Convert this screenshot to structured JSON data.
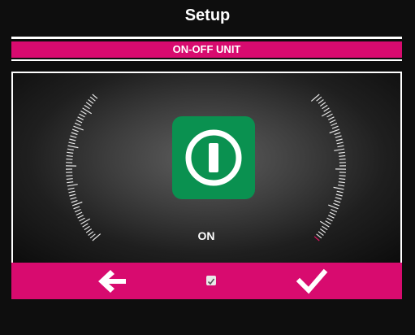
{
  "header": {
    "title": "Setup"
  },
  "section": {
    "title": "ON-OFF UNIT"
  },
  "control": {
    "state_label": "ON",
    "button_color": "#0a9150",
    "icon": "power-icon"
  },
  "footer": {
    "back_icon": "arrow-left-icon",
    "center_icon": "checkbox-icon",
    "confirm_icon": "checkmark-icon",
    "bar_color": "#d80b6f"
  },
  "colors": {
    "accent": "#d80b6f",
    "background": "#0e0e0e",
    "power_green": "#0a9150"
  }
}
